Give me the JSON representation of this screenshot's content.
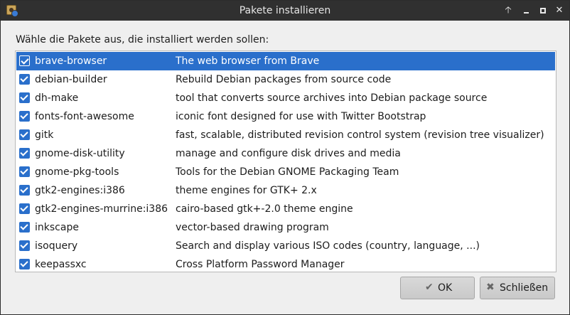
{
  "window": {
    "title": "Pakete installieren",
    "controls": [
      "arrow-up-icon",
      "minimize-icon",
      "maximize-icon",
      "close-icon"
    ]
  },
  "prompt": "Wähle die Pakete aus, die installiert werden sollen:",
  "packages": [
    {
      "name": "brave-browser",
      "description": "The web browser from Brave",
      "checked": true,
      "selected": true
    },
    {
      "name": "debian-builder",
      "description": "Rebuild Debian packages from source code",
      "checked": true,
      "selected": false
    },
    {
      "name": "dh-make",
      "description": "tool that converts source archives into Debian package source",
      "checked": true,
      "selected": false
    },
    {
      "name": "fonts-font-awesome",
      "description": "iconic font designed for use with Twitter Bootstrap",
      "checked": true,
      "selected": false
    },
    {
      "name": "gitk",
      "description": "fast, scalable, distributed revision control system (revision tree visualizer)",
      "checked": true,
      "selected": false
    },
    {
      "name": "gnome-disk-utility",
      "description": "manage and configure disk drives and media",
      "checked": true,
      "selected": false
    },
    {
      "name": "gnome-pkg-tools",
      "description": "Tools for the Debian GNOME Packaging Team",
      "checked": true,
      "selected": false
    },
    {
      "name": "gtk2-engines:i386",
      "description": "theme engines for GTK+ 2.x",
      "checked": true,
      "selected": false
    },
    {
      "name": "gtk2-engines-murrine:i386",
      "description": "cairo-based gtk+-2.0 theme engine",
      "checked": true,
      "selected": false
    },
    {
      "name": "inkscape",
      "description": "vector-based drawing program",
      "checked": true,
      "selected": false
    },
    {
      "name": "isoquery",
      "description": "Search and display various ISO codes (country, language, ...)",
      "checked": true,
      "selected": false
    },
    {
      "name": "keepassxc",
      "description": "Cross Platform Password Manager",
      "checked": true,
      "selected": false
    }
  ],
  "buttons": {
    "ok": {
      "label": "OK",
      "icon": "checkmark-icon"
    },
    "close": {
      "label": "Schließen",
      "icon": "x-icon"
    }
  },
  "colors": {
    "selection": "#2a6fcb",
    "titlebar": "#303030",
    "checkbox": "#2a6fcb"
  }
}
